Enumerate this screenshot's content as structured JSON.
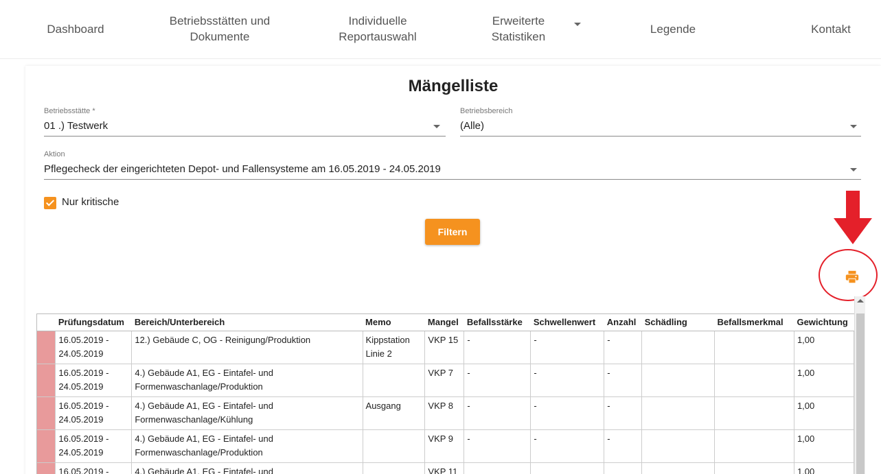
{
  "nav": {
    "items": [
      {
        "label": "Dashboard"
      },
      {
        "label": "Betriebsstätten und\nDokumente"
      },
      {
        "label": "Individuelle\nReportauswahl"
      },
      {
        "label": "Erweiterte\nStatistiken"
      },
      {
        "label": "Legende"
      },
      {
        "label": "Kontakt"
      }
    ]
  },
  "page": {
    "title": "Mängelliste"
  },
  "form": {
    "betriebsstaette": {
      "label": "Betriebsstätte *",
      "value": "01 .) Testwerk"
    },
    "betriebsbereich": {
      "label": "Betriebsbereich",
      "value": "(Alle)"
    },
    "aktion": {
      "label": "Aktion",
      "value": "Pflegecheck der eingerichteten Depot- und Fallensysteme am 16.05.2019 - 24.05.2019"
    },
    "nur_kritische": {
      "label": "Nur kritische",
      "checked": true
    },
    "filter_label": "Filtern"
  },
  "colors": {
    "accent": "#f5921f",
    "annotation": "#e4202a",
    "critical_row": "#e89a9b"
  },
  "table": {
    "headers": [
      "Prüfungsdatum",
      "Bereich/Unterbereich",
      "Memo",
      "Mangel",
      "Befallsstärke",
      "Schwellenwert",
      "Anzahl",
      "Schädling",
      "Befallsmerkmal",
      "Gewichtung"
    ],
    "rows": [
      {
        "datum": "16.05.2019 - 24.05.2019",
        "bereich": "12.) Gebäude C, OG - Reinigung/Produktion",
        "memo": "Kippstation Linie 2",
        "mangel": "VKP 15",
        "befallsstaerke": "-",
        "schwellenwert": "-",
        "anzahl": "-",
        "schaedling": "",
        "befallsmerkmal": "",
        "gewichtung": "1,00"
      },
      {
        "datum": "16.05.2019 - 24.05.2019",
        "bereich": "4.) Gebäude A1, EG - Eintafel- und Formenwaschanlage/Produktion",
        "memo": "",
        "mangel": "VKP 7",
        "befallsstaerke": "-",
        "schwellenwert": "-",
        "anzahl": "-",
        "schaedling": "",
        "befallsmerkmal": "",
        "gewichtung": "1,00"
      },
      {
        "datum": "16.05.2019 - 24.05.2019",
        "bereich": "4.) Gebäude A1, EG - Eintafel- und Formenwaschanlage/Kühlung",
        "memo": "Ausgang",
        "mangel": "VKP 8",
        "befallsstaerke": "-",
        "schwellenwert": "-",
        "anzahl": "-",
        "schaedling": "",
        "befallsmerkmal": "",
        "gewichtung": "1,00"
      },
      {
        "datum": "16.05.2019 - 24.05.2019",
        "bereich": "4.) Gebäude A1, EG - Eintafel- und Formenwaschanlage/Produktion",
        "memo": "",
        "mangel": "VKP 9",
        "befallsstaerke": "-",
        "schwellenwert": "-",
        "anzahl": "-",
        "schaedling": "",
        "befallsmerkmal": "",
        "gewichtung": "1,00"
      },
      {
        "datum": "16.05.2019 -",
        "bereich": "4.) Gebäude A1, EG - Eintafel- und",
        "memo": "",
        "mangel": "VKP 11",
        "befallsstaerke": "",
        "schwellenwert": "",
        "anzahl": "",
        "schaedling": "",
        "befallsmerkmal": "",
        "gewichtung": "1,00"
      }
    ]
  },
  "icons": {
    "print": "print-icon",
    "dropdown": "chevron-down-icon",
    "annotation_arrow": "arrow-down-icon"
  }
}
